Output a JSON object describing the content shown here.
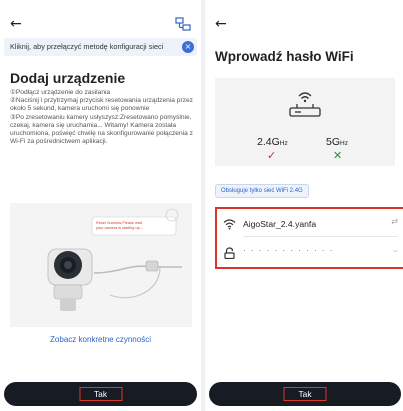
{
  "left_screen": {
    "banner": {
      "text": "Kliknij, aby przełączyć metodę konfiguracji sieci",
      "close_glyph": "×"
    },
    "title": "Dodaj urządzenie",
    "instructions": [
      "①Podłącz urządzenie do zasilania",
      "②Naciśnij i przytrzymaj przycisk resetowania urządzenia przez około 5 sekund, kamera uruchomi się ponownie",
      "③Po zresetowaniu kamery usłyszysz:Zresetowano pomyślnie, czekaj, kamera się uruchamia... Witamy! Kamera została uruchomiona, poświęć chwilę na skonfigurowanie połączenia z Wi-Fi za pośrednictwem aplikacji."
    ],
    "illustration_bubble": "Reset Success,Please wait, your camera is starting up...",
    "link": "Zobacz konkretne czynności",
    "button": "Tak",
    "icons": {
      "back": "back-arrow-icon",
      "network": "network-switch-icon"
    }
  },
  "right_screen": {
    "title": "Wprowadź hasło WiFi",
    "bands": [
      {
        "label": "2.4G",
        "unit": "Hz",
        "supported": true,
        "mark": "✓"
      },
      {
        "label": "5G",
        "unit": "Hz",
        "supported": false,
        "mark": "✕"
      }
    ],
    "chip": "Obsługuje tylko sieć WiFi 2.4G",
    "ssid": "AigoStar_2.4.yanfa",
    "password_mask": "· · · · · · · · · · · ·",
    "switch_glyph": "⇄",
    "eye_glyph": "⌣",
    "button": "Tak",
    "icons": {
      "back": "back-arrow-icon",
      "router": "router-icon",
      "wifi": "wifi-icon",
      "lock": "lock-icon"
    }
  },
  "colors": {
    "accent_blue": "#2f63c8",
    "highlight_red": "#d9362b",
    "button_dark": "#171b24",
    "check_red": "#c9372c",
    "cross_green": "#2a8a4a"
  }
}
